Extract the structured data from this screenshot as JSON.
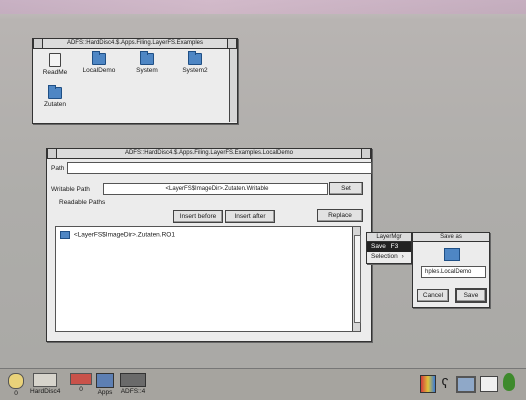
{
  "filer_window": {
    "title": "ADFS::HardDisc4.$.Apps.Filing.LayerFS.Examples",
    "items": [
      "ReadMe",
      "LocalDemo",
      "System",
      "System2",
      "Zutaten"
    ]
  },
  "config_window": {
    "title": "ADFS::HardDisc4.$.Apps.Filing.LayerFS.Examples.LocalDemo",
    "path_label": "Path",
    "path_value": "",
    "writable_label": "Writable Path",
    "writable_value": "<LayerFS$ImageDir>.Zutaten.Writable",
    "set_label": "Set",
    "readable_label": "Readable Paths",
    "insert_before_label": "Insert before",
    "insert_after_label": "Insert after",
    "replace_label": "Replace",
    "readable_list": [
      "<LayerFS$ImageDir>.Zutaten.RO1"
    ]
  },
  "menu": {
    "title": "LayerMgr",
    "items": [
      {
        "label": "Save",
        "shortcut": "F3"
      },
      {
        "label": "Selection",
        "shortcut": ""
      }
    ]
  },
  "save_box": {
    "title": "Save as",
    "filename": "hples.LocalDemo",
    "cancel_label": "Cancel",
    "save_label": "Save"
  },
  "iconbar": {
    "left": [
      {
        "label": "0",
        "icon": "floppy-icon"
      },
      {
        "label": "HardDisc4",
        "icon": "harddisc-icon"
      },
      {
        "label": "0",
        "icon": "ram-icon"
      },
      {
        "label": "Apps",
        "icon": "apps-icon"
      },
      {
        "label": "ADFS::4",
        "icon": "adfs-icon"
      }
    ],
    "right_icons": [
      "palette-icon",
      "clock-icon",
      "display-icon",
      "printer-icon",
      "acorn-icon"
    ]
  },
  "colors": {
    "folder": "#4e86c4",
    "desktop": "#b3b1ad",
    "acorn": "#3e8a2c"
  }
}
